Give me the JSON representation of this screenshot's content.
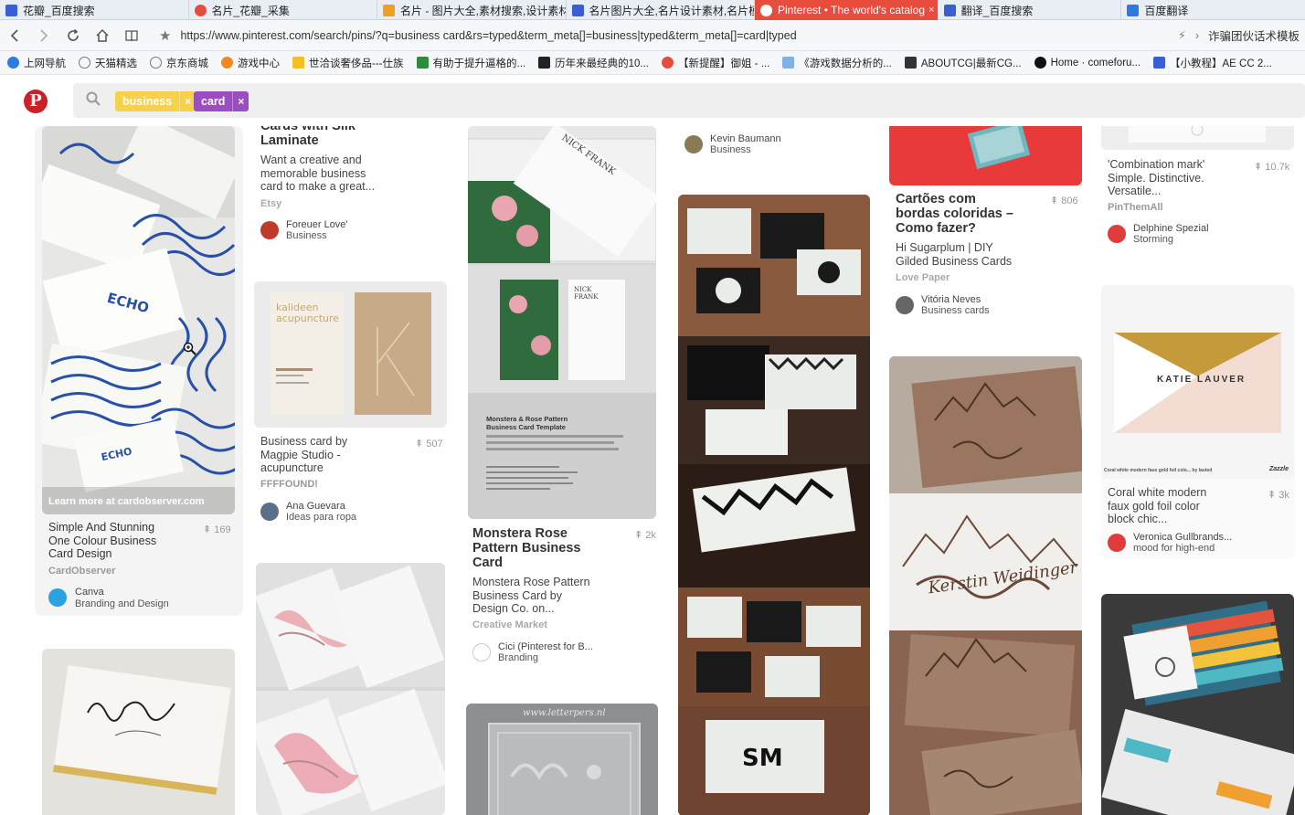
{
  "browser": {
    "tabs": [
      {
        "label": "花瓣_百度搜索",
        "color": "#3b5ed6"
      },
      {
        "label": "名片_花瓣_采集",
        "color": "#e84c3d"
      },
      {
        "label": "名片 - 图片大全,素材搜索,设计素材...",
        "color": "#f0a020"
      },
      {
        "label": "名片图片大全,名片设计素材,名片模板",
        "color": "#3b5ed6"
      },
      {
        "label": "Pinterest • The world's catalog",
        "color": "#ffffff",
        "close": "×"
      },
      {
        "label": "翻译_百度搜索",
        "color": "#3b5ed6"
      },
      {
        "label": "百度翻译",
        "color": "#2d7be0"
      }
    ],
    "url": "https://www.pinterest.com/search/pins/?q=business card&rs=typed&term_meta[]=business|typed&term_meta[]=card|typed",
    "right_text": "诈骗团伙话术模板",
    "bookmarks": [
      {
        "label": "上网导航",
        "color": "#2d7be0"
      },
      {
        "label": "天猫精选",
        "color": "#777777"
      },
      {
        "label": "京东商城",
        "color": "#777777"
      },
      {
        "label": "游戏中心",
        "color": "#f08a20"
      },
      {
        "label": "世洽谈奢侈品---仕族",
        "color": "#f0c020"
      },
      {
        "label": "有助于提升逼格的...",
        "color": "#2e8b3a"
      },
      {
        "label": "历年来最经典的10...",
        "color": "#222222"
      },
      {
        "label": "【新提醒】御姐 - ...",
        "color": "#e84c3d"
      },
      {
        "label": "《游戏数据分析的...",
        "color": "#7fb0e8"
      },
      {
        "label": "ABOUTCG|最新CG...",
        "color": "#333333"
      },
      {
        "label": "Home · comeforu...",
        "color": "#111111"
      },
      {
        "label": "【小教程】AE CC 2...",
        "color": "#3b5ed6"
      }
    ]
  },
  "pinterest": {
    "logo": "P",
    "tags": [
      {
        "label": "business",
        "close": "×"
      },
      {
        "label": "card",
        "close": "×"
      }
    ],
    "pins": {
      "col1_a": {
        "overlay": "Learn more at cardobserver.com",
        "title": "Simple And Stunning One Colour Business Card Design",
        "saves": "169",
        "source": "CardObserver",
        "user": "Canva",
        "board": "Branding and Design"
      },
      "col2_a": {
        "title": "Cards with Silk Laminate",
        "desc": "Want a creative and memorable business card to make a great...",
        "source": "Etsy",
        "user": "Foreuer Love'",
        "board": "Business"
      },
      "col2_b": {
        "desc": "Business card by Magpie Studio - acupuncture",
        "saves": "507",
        "source": "FFFFOUND!",
        "user": "Ana Guevara",
        "board": "Ideas para ropa",
        "img_text": "kalideen acupuncture"
      },
      "col3_a": {
        "title": "Monstera Rose Pattern Business Card",
        "desc": "Monstera Rose Pattern Business Card by Design Co. on...",
        "saves": "2k",
        "source": "Creative Market",
        "user": "Cici (Pinterest for B...",
        "board": "Branding",
        "img_heading": "Monstera & Rose Pattern Business Card Template",
        "img_name": "NICK FRANK"
      },
      "col3_b": {
        "img_text": "www.letterpers.nl"
      },
      "col4_a": {
        "user": "Kevin Baumann",
        "board": "Business"
      },
      "col5_a": {
        "title": "Cartões com bordas coloridas – Como fazer?",
        "desc": "Hi Sugarplum | DIY Gilded Business Cards",
        "saves": "806",
        "source": "Love Paper",
        "user": "Vitória Neves",
        "board": "Business cards"
      },
      "col5_b": {
        "img_text": "Kerstin Weidinger"
      },
      "col6_a": {
        "desc": "'Combination mark' Simple. Distinctive. Versatile...",
        "saves": "10.7k",
        "source": "PinThemAll",
        "user": "Delphine Spezial",
        "board": "Storming"
      },
      "col6_b": {
        "desc": "Coral white modern faux gold foil color block chic...",
        "saves": "3k",
        "user": "Veronica Gullbrands...",
        "board": "mood for high-end",
        "img_text": "KATIE LAUVER",
        "img_caption": "Coral white modern faux gold foil colo... by lauted",
        "img_brand": "Zazzle"
      }
    }
  }
}
